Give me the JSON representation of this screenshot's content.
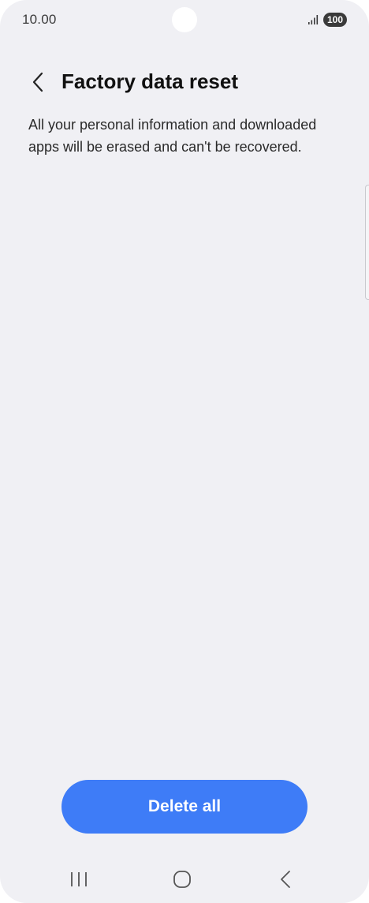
{
  "status_bar": {
    "time": "10.00",
    "battery": "100",
    "icons": [
      "signal-icon",
      "battery-icon"
    ]
  },
  "header": {
    "back_icon": "chevron-left-icon",
    "title": "Factory data reset"
  },
  "content": {
    "description": "All your personal information and downloaded apps will be erased and can't be recovered."
  },
  "actions": {
    "delete_label": "Delete all"
  },
  "nav_bar": {
    "icons": [
      "recents-icon",
      "home-icon",
      "back-icon"
    ]
  },
  "colors": {
    "background": "#f0f0f4",
    "accent": "#3e7cf7",
    "title": "#111111",
    "text": "#2a2a2a"
  }
}
